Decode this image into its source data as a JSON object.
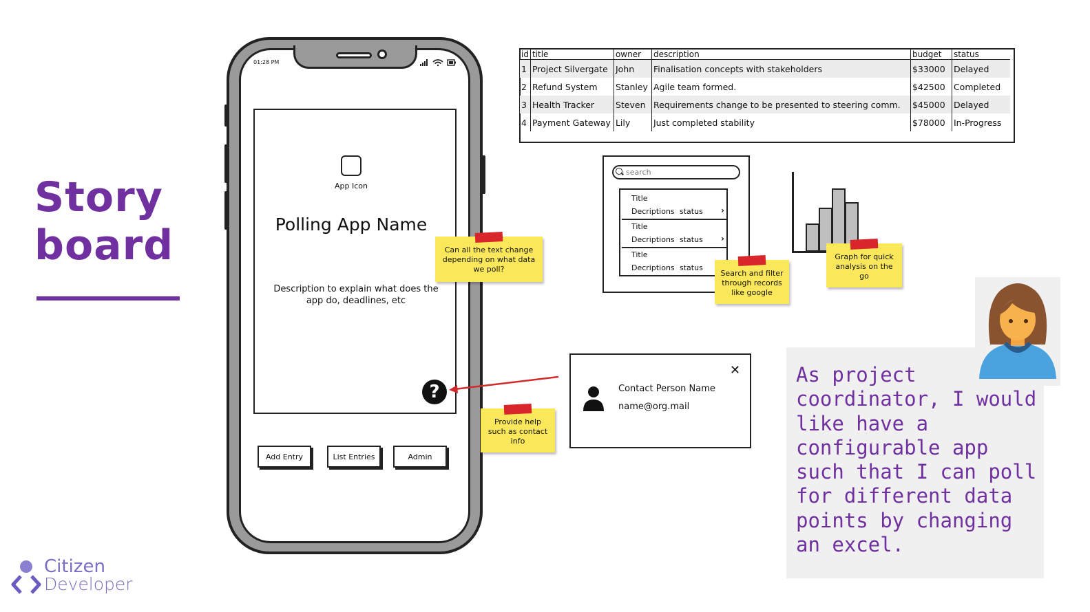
{
  "slide": {
    "title_line1": "Story",
    "title_line2": "board"
  },
  "phone": {
    "status_time": "01:28 PM",
    "app_icon_label": "App Icon",
    "app_name": "Polling App Name",
    "description": "Description to explain what does the app do, deadlines, etc",
    "help_glyph": "?",
    "buttons": {
      "add_entry": "Add Entry",
      "list_entries": "List Entries",
      "admin": "Admin"
    }
  },
  "notes": {
    "text_change": "Can all the text change depending on what data we poll?",
    "provide_help": "Provide help such as contact info",
    "search_filter": "Search and filter through records like google",
    "graph": "Graph for quick analysis on the go"
  },
  "data_table": {
    "headers": [
      "id",
      "title",
      "owner",
      "description",
      "budget",
      "status"
    ],
    "rows": [
      [
        "1",
        "Project Silvergate",
        "John",
        "Finalisation concepts with stakeholders",
        "$33000",
        "Delayed"
      ],
      [
        "2",
        "Refund System",
        "Stanley",
        "Agile team formed.",
        "$42500",
        "Completed"
      ],
      [
        "3",
        "Health Tracker",
        "Steven",
        "Requirements change to be presented to steering comm.",
        "$45000",
        "Delayed"
      ],
      [
        "4",
        "Payment Gateway",
        "Lily",
        "Just completed stability",
        "$78000",
        "In-Progress"
      ]
    ]
  },
  "list_mockup": {
    "search_placeholder": "search",
    "items": [
      {
        "title": "Title",
        "desc": "Decriptions",
        "status": "status"
      },
      {
        "title": "Title",
        "desc": "Decriptions",
        "status": "status"
      },
      {
        "title": "Title",
        "desc": "Decriptions",
        "status": "status"
      }
    ]
  },
  "chart_mockup": {
    "bar_levels": [
      0.34,
      0.53,
      0.77,
      0.6
    ]
  },
  "contact_dialog": {
    "name": "Contact Person Name",
    "email": "name@org.mail",
    "close_glyph": "✕"
  },
  "user_story": {
    "text": "As project coordinator, I would like have a configurable app such that I can poll for different data points by changing an excel."
  },
  "logo": {
    "line1": "Citizen",
    "line2": "Developer"
  },
  "colors": {
    "accent_purple": "#7030a0",
    "sticky_yellow": "#fbe85a",
    "tape_red": "#d8262a",
    "arrow_red": "#d02a2a"
  }
}
